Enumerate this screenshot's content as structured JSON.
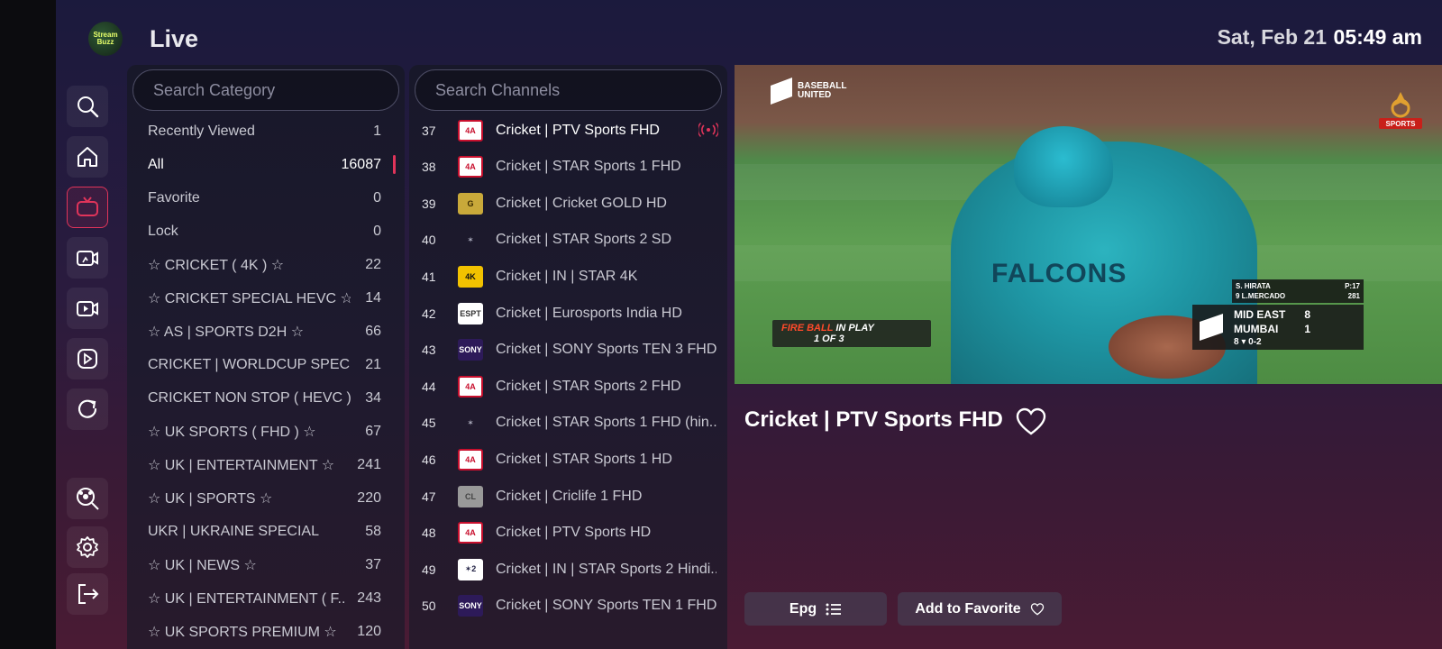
{
  "header": {
    "logo_text_1": "Stream",
    "logo_text_2": "Buzz",
    "title": "Live",
    "date": "Sat, Feb 21",
    "time": "05:49 am"
  },
  "nav": {
    "items": [
      {
        "icon": "search-icon",
        "active": false
      },
      {
        "icon": "home-icon",
        "active": false
      },
      {
        "icon": "tv-icon",
        "active": true
      },
      {
        "icon": "movie-icon",
        "active": false
      },
      {
        "icon": "series-icon",
        "active": false
      },
      {
        "icon": "play-icon",
        "active": false
      },
      {
        "icon": "refresh-icon",
        "active": false
      },
      {
        "icon": "sports-icon",
        "active": false
      },
      {
        "icon": "settings-icon",
        "active": false
      },
      {
        "icon": "logout-icon",
        "active": false
      }
    ]
  },
  "categories": {
    "search_placeholder": "Search Category",
    "items": [
      {
        "name": "Recently Viewed",
        "count": "1"
      },
      {
        "name": "All",
        "count": "16087",
        "selected": true
      },
      {
        "name": "Favorite",
        "count": "0"
      },
      {
        "name": "Lock",
        "count": "0"
      },
      {
        "name": "☆ CRICKET ( 4K ) ☆",
        "count": "22"
      },
      {
        "name": "☆ CRICKET SPECIAL HEVC ☆",
        "count": "14"
      },
      {
        "name": "☆ AS | SPORTS D2H ☆",
        "count": "66"
      },
      {
        "name": "CRICKET | WORLDCUP SPECI..",
        "count": "21"
      },
      {
        "name": "CRICKET NON STOP ( HEVC )",
        "count": "34"
      },
      {
        "name": "☆ UK SPORTS ( FHD ) ☆",
        "count": "67"
      },
      {
        "name": "☆ UK | ENTERTAINMENT ☆",
        "count": "241"
      },
      {
        "name": "☆ UK | SPORTS ☆",
        "count": "220"
      },
      {
        "name": "UKR | UKRAINE SPECIAL",
        "count": "58"
      },
      {
        "name": "☆ UK | NEWS ☆",
        "count": "37"
      },
      {
        "name": "☆ UK | ENTERTAINMENT ( F..",
        "count": "243"
      },
      {
        "name": "☆ UK SPORTS PREMIUM ☆",
        "count": "120"
      }
    ]
  },
  "channels": {
    "search_placeholder": "Search Channels",
    "items": [
      {
        "num": "37",
        "logo": "4A",
        "logo_style": "lb-4a",
        "name": "Cricket | PTV Sports FHD",
        "playing": true
      },
      {
        "num": "38",
        "logo": "4A",
        "logo_style": "lb-4a",
        "name": "Cricket | STAR Sports 1 FHD"
      },
      {
        "num": "39",
        "logo": "G",
        "logo_style": "lb-gold",
        "name": "Cricket | Cricket GOLD HD"
      },
      {
        "num": "40",
        "logo": "✶",
        "logo_style": "lb-star",
        "name": "Cricket | STAR Sports 2 SD"
      },
      {
        "num": "41",
        "logo": "4K",
        "logo_style": "lb-4k",
        "name": "Cricket | IN | STAR 4K"
      },
      {
        "num": "42",
        "logo": "ESPT",
        "logo_style": "lb-euro",
        "name": "Cricket | Eurosports India HD"
      },
      {
        "num": "43",
        "logo": "SONY",
        "logo_style": "lb-sony",
        "name": "Cricket | SONY Sports TEN 3 FHD"
      },
      {
        "num": "44",
        "logo": "4A",
        "logo_style": "lb-4a",
        "name": "Cricket | STAR Sports 2 FHD"
      },
      {
        "num": "45",
        "logo": "✶",
        "logo_style": "lb-star",
        "name": "Cricket | STAR Sports 1 FHD (hin.."
      },
      {
        "num": "46",
        "logo": "4A",
        "logo_style": "lb-4a",
        "name": "Cricket | STAR Sports 1 HD"
      },
      {
        "num": "47",
        "logo": "CL",
        "logo_style": "lb-cric",
        "name": "Cricket | Criclife 1 FHD"
      },
      {
        "num": "48",
        "logo": "4A",
        "logo_style": "lb-4a",
        "name": "Cricket | PTV Sports HD"
      },
      {
        "num": "49",
        "logo": "✶2",
        "logo_style": "lb-star2",
        "name": "Cricket | IN | STAR Sports 2 Hindi.."
      },
      {
        "num": "50",
        "logo": "SONY",
        "logo_style": "lb-sony",
        "name": "Cricket | SONY Sports TEN 1 FHD"
      }
    ]
  },
  "player": {
    "overlay_brand_line1": "BASEBALL",
    "overlay_brand_line2": "UNITED",
    "jersey_text": "FALCONS",
    "fireball_line1": "FIRE BALL",
    "fireball_line1b": "IN PLAY",
    "fireball_line2": "1 OF 3",
    "score_top_line1_name": "S. HIRATA",
    "score_top_line1_stat": "P:17",
    "score_top_line2_name": "9  L.MERCADO",
    "score_top_line2_stat": "281",
    "team1": "MID EAST",
    "team1_score": "8",
    "team2": "MUMBAI",
    "team2_score": "1",
    "inning_info": "8 ▾  0-2",
    "sports_logo_text": "SPORTS"
  },
  "now_playing": {
    "title": "Cricket | PTV Sports FHD"
  },
  "actions": {
    "epg_label": "Epg",
    "favorite_label": "Add to Favorite"
  },
  "colors": {
    "accent": "#e0345a"
  }
}
